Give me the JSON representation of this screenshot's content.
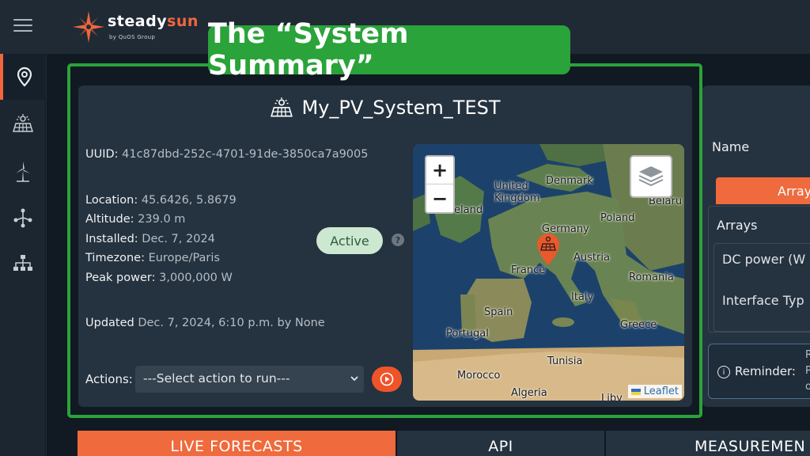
{
  "app": {
    "brand_main": "steady",
    "brand_accent": "sun",
    "brand_sub": "by QuOS Group",
    "accent_color": "#f2663d"
  },
  "sidebar": {
    "items": [
      {
        "icon": "location-pin-icon",
        "active": true
      },
      {
        "icon": "solar-panel-icon",
        "active": false
      },
      {
        "icon": "wind-turbine-icon",
        "active": false
      },
      {
        "icon": "network-node-icon",
        "active": false
      },
      {
        "icon": "hierarchy-icon",
        "active": false
      }
    ]
  },
  "callout": {
    "text": "The “System Summary”",
    "color": "#2aa33a"
  },
  "summary": {
    "title": "My_PV_System_TEST",
    "uuid_label": "UUID:",
    "uuid_value": "41c87dbd-252c-4701-91de-3850ca7a9005",
    "location_label": "Location:",
    "location_value": "45.6426, 5.8679",
    "altitude_label": "Altitude:",
    "altitude_value": "239.0 m",
    "installed_label": "Installed:",
    "installed_value": "Dec. 7, 2024",
    "timezone_label": "Timezone:",
    "timezone_value": "Europe/Paris",
    "peak_label": "Peak power:",
    "peak_value": "3,000,000 W",
    "updated_label": "Updated",
    "updated_value": "Dec. 7, 2024, 6:10 p.m. by None",
    "status": "Active",
    "help": "?",
    "actions_label": "Actions:",
    "action_select": "---Select action to run---"
  },
  "map": {
    "zoom_in": "+",
    "zoom_out": "−",
    "attribution": "Leaflet",
    "labels": {
      "uk": "United\nKingdom",
      "ireland": "eland",
      "denmark": "Denmark",
      "belarus": "Belaru",
      "poland": "Poland",
      "germany": "Germany",
      "france": "France",
      "austria": "Austria",
      "romania": "Romania",
      "italy": "Italy",
      "spain": "Spain",
      "portugal": "Portugal",
      "greece": "Greece",
      "tunisia": "Tunisia",
      "morocco": "Morocco",
      "algeria": "Algeria",
      "libya": "Liby"
    }
  },
  "right_panel": {
    "name_label": "Name",
    "tab_label": "Arrays",
    "box_title": "Arrays",
    "dc_power": "DC power (W",
    "interface_type": "Interface Typ",
    "reminder_label": "Reminder:",
    "reminder_frag1": "R",
    "reminder_frag2": "P",
    "reminder_frag3": "o"
  },
  "bottom_tabs": {
    "live": "LIVE FORECASTS",
    "api": "API",
    "measurements": "MEASUREMEN"
  }
}
